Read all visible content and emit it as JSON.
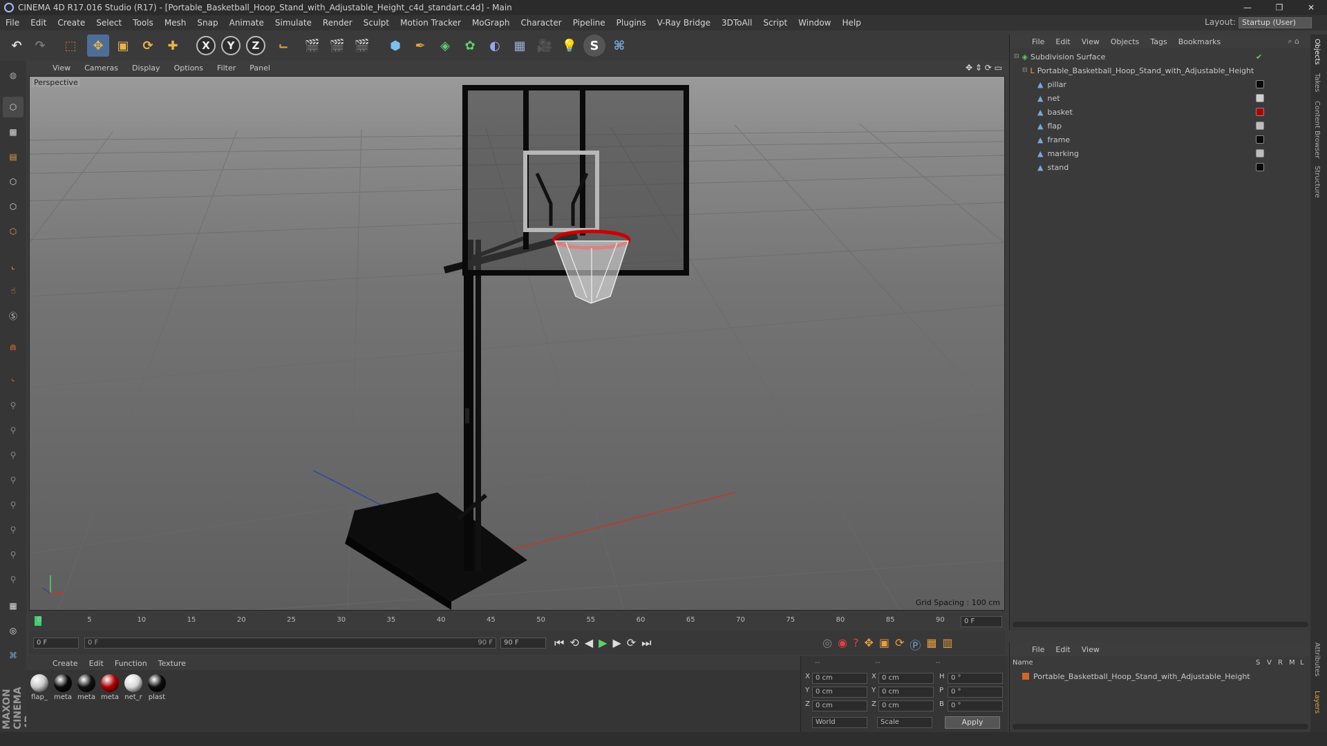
{
  "window": {
    "title": "CINEMA 4D R17.016 Studio (R17) - [Portable_Basketball_Hoop_Stand_with_Adjustable_Height_c4d_standart.c4d] - Main",
    "controls": [
      "—",
      "❐",
      "✕"
    ]
  },
  "menubar": {
    "items": [
      "File",
      "Edit",
      "Create",
      "Select",
      "Tools",
      "Mesh",
      "Snap",
      "Animate",
      "Simulate",
      "Render",
      "Sculpt",
      "Motion Tracker",
      "MoGraph",
      "Character",
      "Pipeline",
      "Plugins",
      "V-Ray Bridge",
      "3DToAll",
      "Script",
      "Window",
      "Help"
    ],
    "layout_label": "Layout:",
    "layout_value": "Startup (User)"
  },
  "toolbar": {
    "axis_x": "X",
    "axis_y": "Y",
    "axis_z": "Z"
  },
  "viewport": {
    "menu": [
      "View",
      "Cameras",
      "Display",
      "Options",
      "Filter",
      "Panel"
    ],
    "label": "Perspective",
    "grid_spacing": "Grid Spacing : 100 cm"
  },
  "timeline": {
    "ticks": [
      "0",
      "5",
      "10",
      "15",
      "20",
      "25",
      "30",
      "35",
      "40",
      "45",
      "50",
      "55",
      "60",
      "65",
      "70",
      "75",
      "80",
      "85",
      "90"
    ],
    "current_frame": "0 F",
    "start_field": "0 F",
    "range_start": "0 F",
    "range_end": "90 F",
    "end_field": "90 F"
  },
  "materials": {
    "menu": [
      "Create",
      "Edit",
      "Function",
      "Texture"
    ],
    "items": [
      {
        "name": "flap_",
        "color": "#c8c8c8"
      },
      {
        "name": "meta",
        "color": "#0a0a0a"
      },
      {
        "name": "meta",
        "color": "#111111"
      },
      {
        "name": "meta",
        "color": "#b00000"
      },
      {
        "name": "net_r",
        "color": "#d8d8d8"
      },
      {
        "name": "plast",
        "color": "#0c0c0c"
      }
    ]
  },
  "coords": {
    "header": [
      "--",
      "--",
      "--"
    ],
    "rows": [
      {
        "a": "X",
        "av": "0 cm",
        "b": "X",
        "bv": "0 cm",
        "c": "H",
        "cv": "0 °"
      },
      {
        "a": "Y",
        "av": "0 cm",
        "b": "Y",
        "bv": "0 cm",
        "c": "P",
        "cv": "0 °"
      },
      {
        "a": "Z",
        "av": "0 cm",
        "b": "Z",
        "bv": "0 cm",
        "c": "B",
        "cv": "0 °"
      }
    ],
    "world": "World",
    "scale": "Scale",
    "apply": "Apply"
  },
  "objects": {
    "menu": [
      "File",
      "Edit",
      "View",
      "Objects",
      "Tags",
      "Bookmarks"
    ],
    "root": "Subdivision Surface",
    "group": "Portable_Basketball_Hoop_Stand_with_Adjustable_Height",
    "children": [
      {
        "name": "pillar",
        "mat": "#0a0a0a"
      },
      {
        "name": "net",
        "mat": "#cfcfcf"
      },
      {
        "name": "basket",
        "mat": "#b00000"
      },
      {
        "name": "flap",
        "mat": "#bdbdbd"
      },
      {
        "name": "frame",
        "mat": "#0a0a0a"
      },
      {
        "name": "marking",
        "mat": "#bdbdbd"
      },
      {
        "name": "stand",
        "mat": "#0a0a0a"
      }
    ]
  },
  "layers": {
    "menu": [
      "File",
      "Edit",
      "View"
    ],
    "columns": [
      "Name",
      "S",
      "V",
      "R",
      "M",
      "L"
    ],
    "row": "Portable_Basketball_Hoop_Stand_with_Adjustable_Height"
  },
  "rightstrip": [
    "Objects",
    "Takes",
    "Content Browser",
    "Structure",
    "Attributes",
    "Layers"
  ],
  "brand": "MAXON CINEMA 4D",
  "colors": {
    "accent": "#4e6e98",
    "tag_orange": "#d4652a"
  }
}
